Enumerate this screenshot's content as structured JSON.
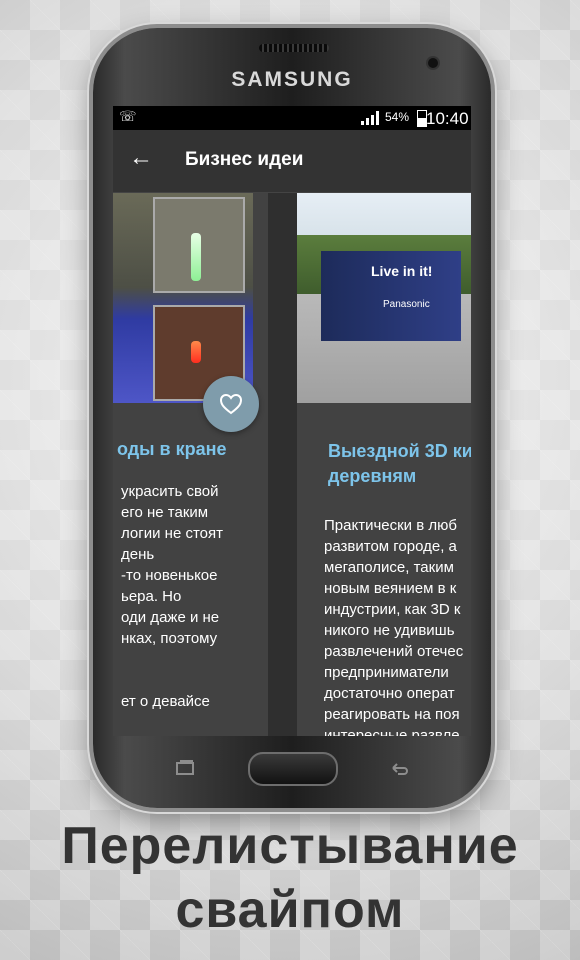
{
  "phone": {
    "brand": "SAMSUNG"
  },
  "status_bar": {
    "battery": "54%",
    "time": "10:40"
  },
  "app_bar": {
    "title": "Бизнес идеи"
  },
  "cards": [
    {
      "title": "оды в кране",
      "text": "украсить свой\n его не таким\nлогии не стоят\n день\n-то новенькое\nьера. Но\nоди даже и не\nнках, поэтому\n\n\nет о девайсе"
    },
    {
      "title": "Выездной 3D ки\nдеревням",
      "text": "Практически в люб\nразвитом городе, а\nмегаполисе, таким\nновым веянием в к\nиндустрии, как 3D к\nникого не удивишь\nразвлечений отечес\nпредприниматели \nдостаточно операт\nреагировать на поя\nинтересные развле",
      "image_text": "Live in it!",
      "image_brand": "Panasonic"
    }
  ],
  "caption": {
    "line1": "Перелистывание",
    "line2": "свайпом"
  }
}
